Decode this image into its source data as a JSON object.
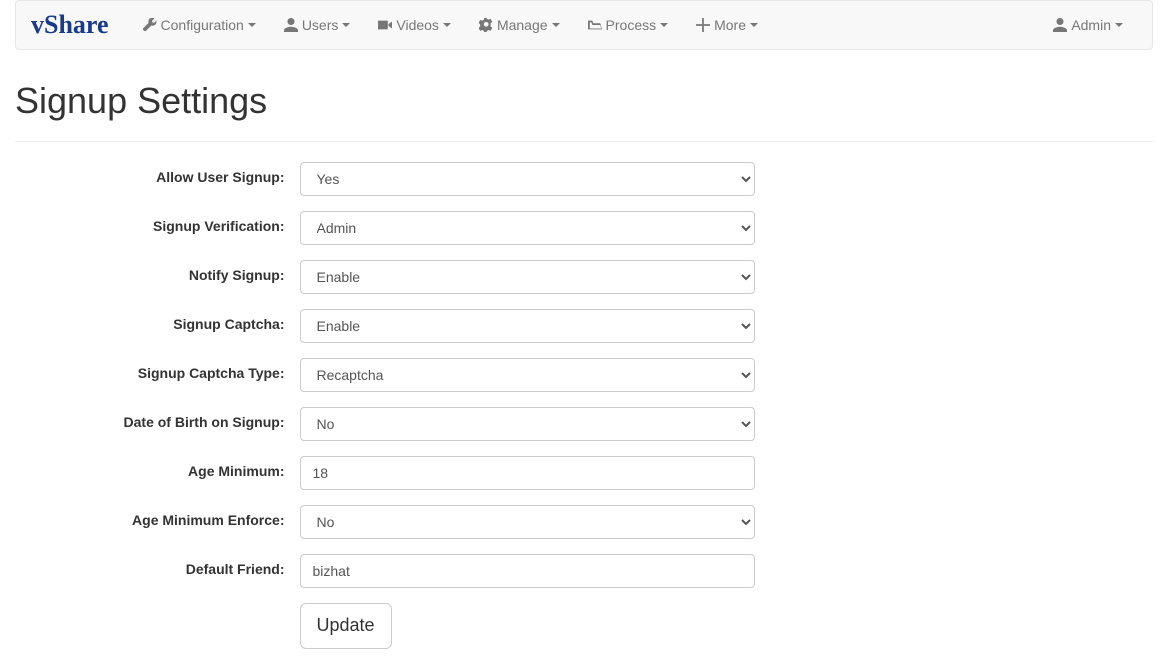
{
  "brand": "vShare",
  "nav": {
    "configuration": "Configuration",
    "users": "Users",
    "videos": "Videos",
    "manage": "Manage",
    "process": "Process",
    "more": "More",
    "admin": "Admin"
  },
  "page_title": "Signup Settings",
  "form": {
    "allow_signup": {
      "label": "Allow User Signup:",
      "value": "Yes"
    },
    "signup_verification": {
      "label": "Signup Verification:",
      "value": "Admin"
    },
    "notify_signup": {
      "label": "Notify Signup:",
      "value": "Enable"
    },
    "signup_captcha": {
      "label": "Signup Captcha:",
      "value": "Enable"
    },
    "signup_captcha_type": {
      "label": "Signup Captcha Type:",
      "value": "Recaptcha"
    },
    "dob_on_signup": {
      "label": "Date of Birth on Signup:",
      "value": "No"
    },
    "age_minimum": {
      "label": "Age Minimum:",
      "value": "18"
    },
    "age_minimum_enforce": {
      "label": "Age Minimum Enforce:",
      "value": "No"
    },
    "default_friend": {
      "label": "Default Friend:",
      "value": "bizhat"
    },
    "submit": "Update"
  }
}
